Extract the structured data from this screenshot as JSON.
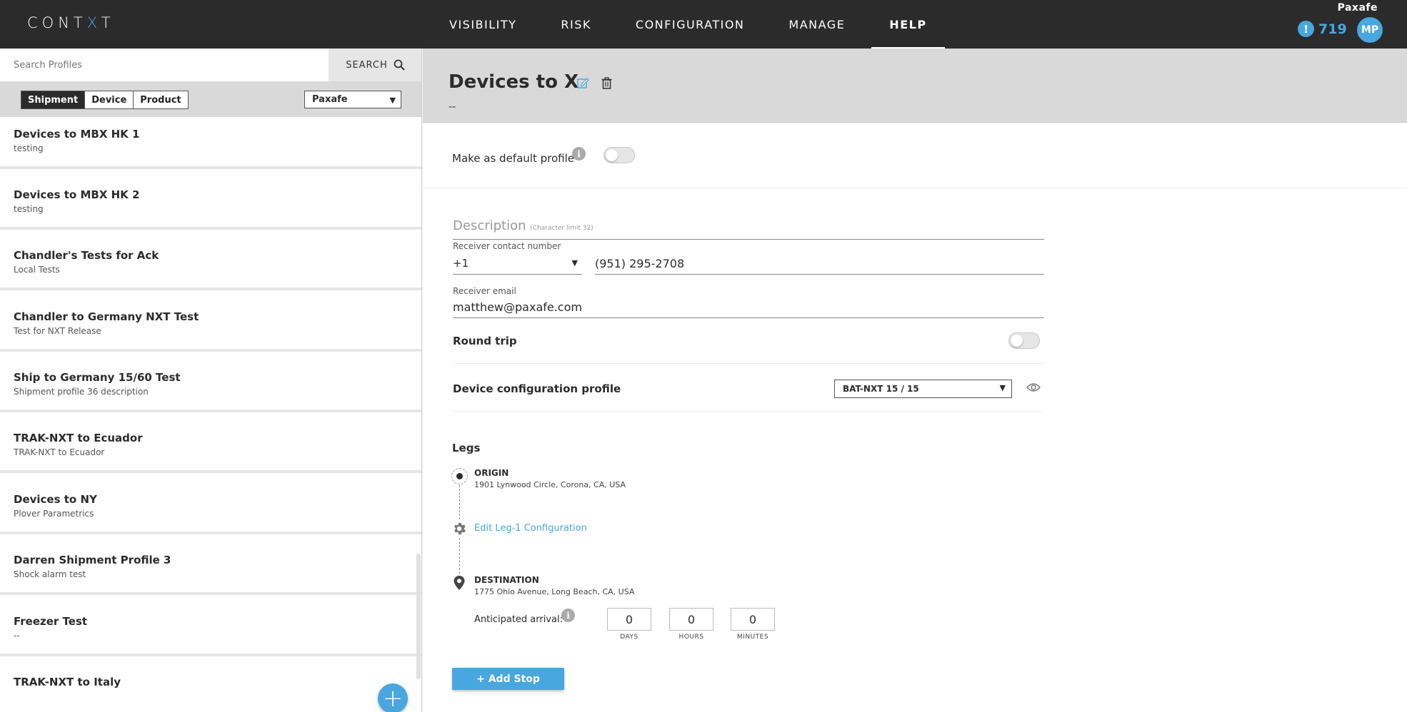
{
  "header": {
    "logo_pre": "CONT",
    "logo_x": "X",
    "logo_post": "T",
    "nav": [
      {
        "label": "VISIBILITY",
        "active": false
      },
      {
        "label": "RISK",
        "active": false
      },
      {
        "label": "CONFIGURATION",
        "active": false
      },
      {
        "label": "MANAGE",
        "active": false
      },
      {
        "label": "HELP",
        "active": true
      }
    ],
    "org_name": "Paxafe",
    "alert_count": "719",
    "avatar_initials": "MP",
    "accent_color": "#48a7df"
  },
  "sidebar": {
    "search_placeholder": "Search Profiles",
    "search_button": "SEARCH",
    "filters": [
      "Shipment",
      "Device",
      "Product"
    ],
    "active_filter": "Shipment",
    "org_select": "Paxafe",
    "profiles": [
      {
        "name": "Devices to MBX HK 1",
        "desc": "testing"
      },
      {
        "name": "Devices to MBX HK 2",
        "desc": "testing"
      },
      {
        "name": "Chandler's Tests for Ack",
        "desc": "Local Tests"
      },
      {
        "name": "Chandler to Germany NXT Test",
        "desc": "Test for NXT Release"
      },
      {
        "name": "Ship to Germany 15/60 Test",
        "desc": "Shipment profile 36 description"
      },
      {
        "name": "TRAK-NXT to Ecuador",
        "desc": "TRAK-NXT to Ecuador"
      },
      {
        "name": "Devices to NY",
        "desc": "Plover Parametrics"
      },
      {
        "name": "Darren Shipment Profile 3",
        "desc": "Shock alarm test"
      },
      {
        "name": "Freezer Test",
        "desc": "--"
      },
      {
        "name": "TRAK-NXT to Italy",
        "desc": ""
      }
    ]
  },
  "profile": {
    "title": "Devices to X",
    "subtitle": "--",
    "default_label": "Make as default profile",
    "default_on": false,
    "description_label": "Description",
    "description_hint": "(Character limit 32)",
    "receiver_contact_label": "Receiver contact number",
    "country_code": "+1",
    "phone": "(951) 295-2708",
    "receiver_email_label": "Receiver email",
    "email": "matthew@paxafe.com",
    "round_trip_label": "Round trip",
    "round_trip_on": false,
    "device_config_label": "Device configuration profile",
    "device_config_value": "BAT-NXT 15 / 15",
    "legs_title": "Legs",
    "origin_label": "ORIGIN",
    "origin_address": "1901 Lynwood Circle, Corona, CA, USA",
    "edit_leg_label": "Edit Leg-1 Configuration",
    "destination_label": "DESTINATION",
    "destination_address": "1775 Ohio Avenue, Long Beach, CA, USA",
    "arrival_label": "Anticipated arrival:",
    "arrival": {
      "days": "0",
      "days_label": "DAYS",
      "hours": "0",
      "hours_label": "HOURS",
      "minutes": "0",
      "minutes_label": "MINUTES"
    },
    "add_stop_label": "+ Add Stop"
  }
}
